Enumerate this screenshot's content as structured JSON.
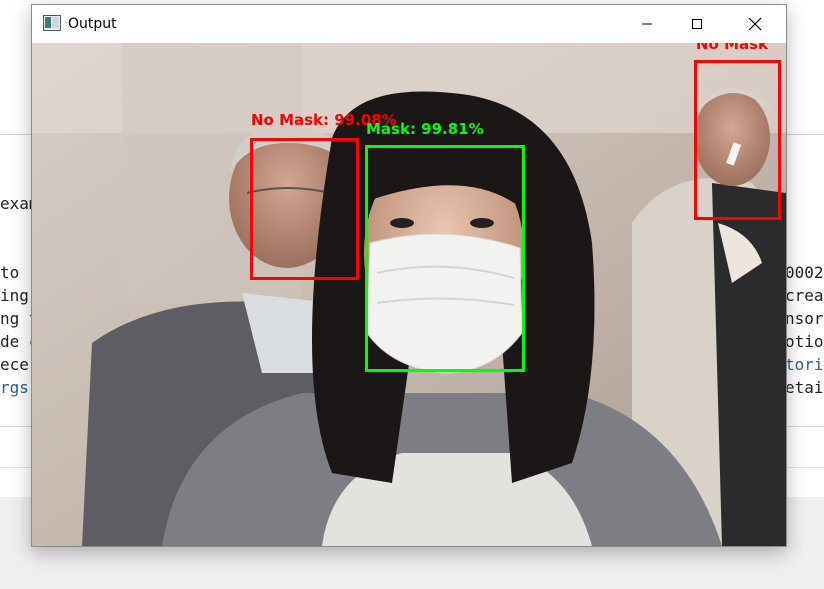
{
  "window": {
    "title": "Output",
    "controls": [
      "minimize",
      "maximize",
      "close"
    ]
  },
  "background": {
    "lines": [
      {
        "text": "exam",
        "left": true
      },
      {
        "text": "to ",
        "left": true
      },
      {
        "text": "ing ",
        "left": true
      },
      {
        "text": "ng t",
        "left": true
      },
      {
        "text": "de c",
        "left": true
      },
      {
        "text": "ece",
        "left": true
      },
      {
        "text": "rgs",
        "left": true,
        "link": true
      },
      {
        "text": "0002",
        "left": false
      },
      {
        "text": "crea",
        "left": false
      },
      {
        "text": "nsor",
        "left": false
      },
      {
        "text": "otio",
        "left": false
      },
      {
        "text": "tori",
        "left": false,
        "link": true
      },
      {
        "text": "etai",
        "left": false
      }
    ]
  },
  "detections": [
    {
      "label": "No Mask: 99.08%",
      "class": "no_mask",
      "color": "#ff0000"
    },
    {
      "label": "Mask: 99.81%",
      "class": "mask",
      "color": "#00ff00"
    },
    {
      "label": "No Mask",
      "class": "no_mask",
      "color": "#ff0000"
    }
  ]
}
